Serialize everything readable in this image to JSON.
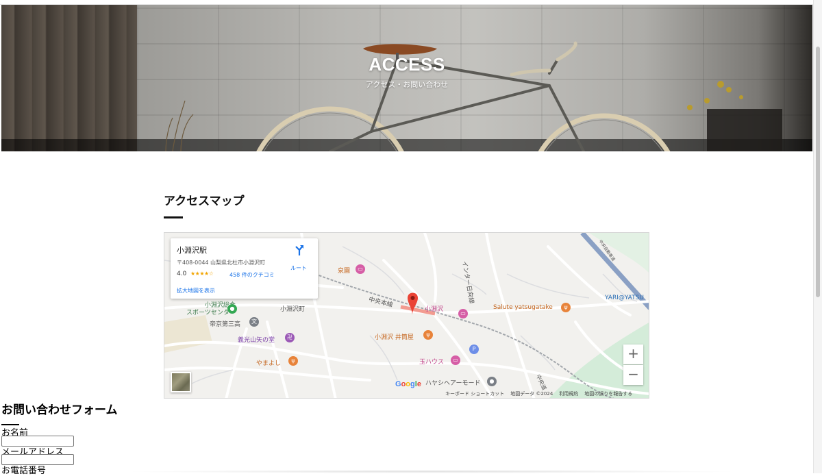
{
  "hero": {
    "title": "ACCESS",
    "subtitle": "アクセス・お問い合わせ"
  },
  "access_section": {
    "heading": "アクセスマップ"
  },
  "map": {
    "infocard": {
      "place_name": "小淵沢駅",
      "address": "〒408-0044 山梨県北杜市小淵沢町",
      "rating": "4.0",
      "stars": "★★★★☆",
      "reviews_link": "458 件のクチコミ",
      "directions_label": "ルート",
      "larger_map_link": "拡大地図を表示"
    },
    "labels": {
      "izumien": "泉園",
      "chuo_line": "中央本線",
      "kobuchizawa_station": "小淵沢",
      "salute": "Salute yatsugatake",
      "yari": "YARI@YATSU",
      "sports_center": "小淵沢総合\nスポーツセンター",
      "kobuchizawa_town": "小淵沢町",
      "teikyo": "帝京第三高",
      "yakoyama": "義光山矢の堂",
      "izutsuya": "小淵沢 井筒屋",
      "tama_house": "玉ハウス",
      "yamayoshi": "やまよし",
      "hayashi": "ハヤシヘアーモード",
      "interchange": "インター日向線",
      "chuo_expressway": "中央道",
      "expressway_ramp": "中央自動車道"
    },
    "zoom_in": "+",
    "zoom_out": "−",
    "google_logo": "Google",
    "attribution": {
      "shortcuts": "キーボード ショートカット",
      "map_data": "地図データ ©2024",
      "terms": "利用規約",
      "report": "地図の誤りを報告する"
    }
  },
  "contact_form": {
    "heading": "お問い合わせフォーム",
    "fields": {
      "name_label": "お名前",
      "email_label": "メールアドレス",
      "phone_label": "お電話番号"
    }
  },
  "colors": {
    "link_blue": "#1a73e8",
    "map_bg": "#f2f1ee",
    "road": "#ffffff",
    "rail": "#9aa0a6",
    "pin_red": "#ea4335",
    "food_orange": "#e8833a",
    "hotel_pink": "#d65ea6"
  }
}
